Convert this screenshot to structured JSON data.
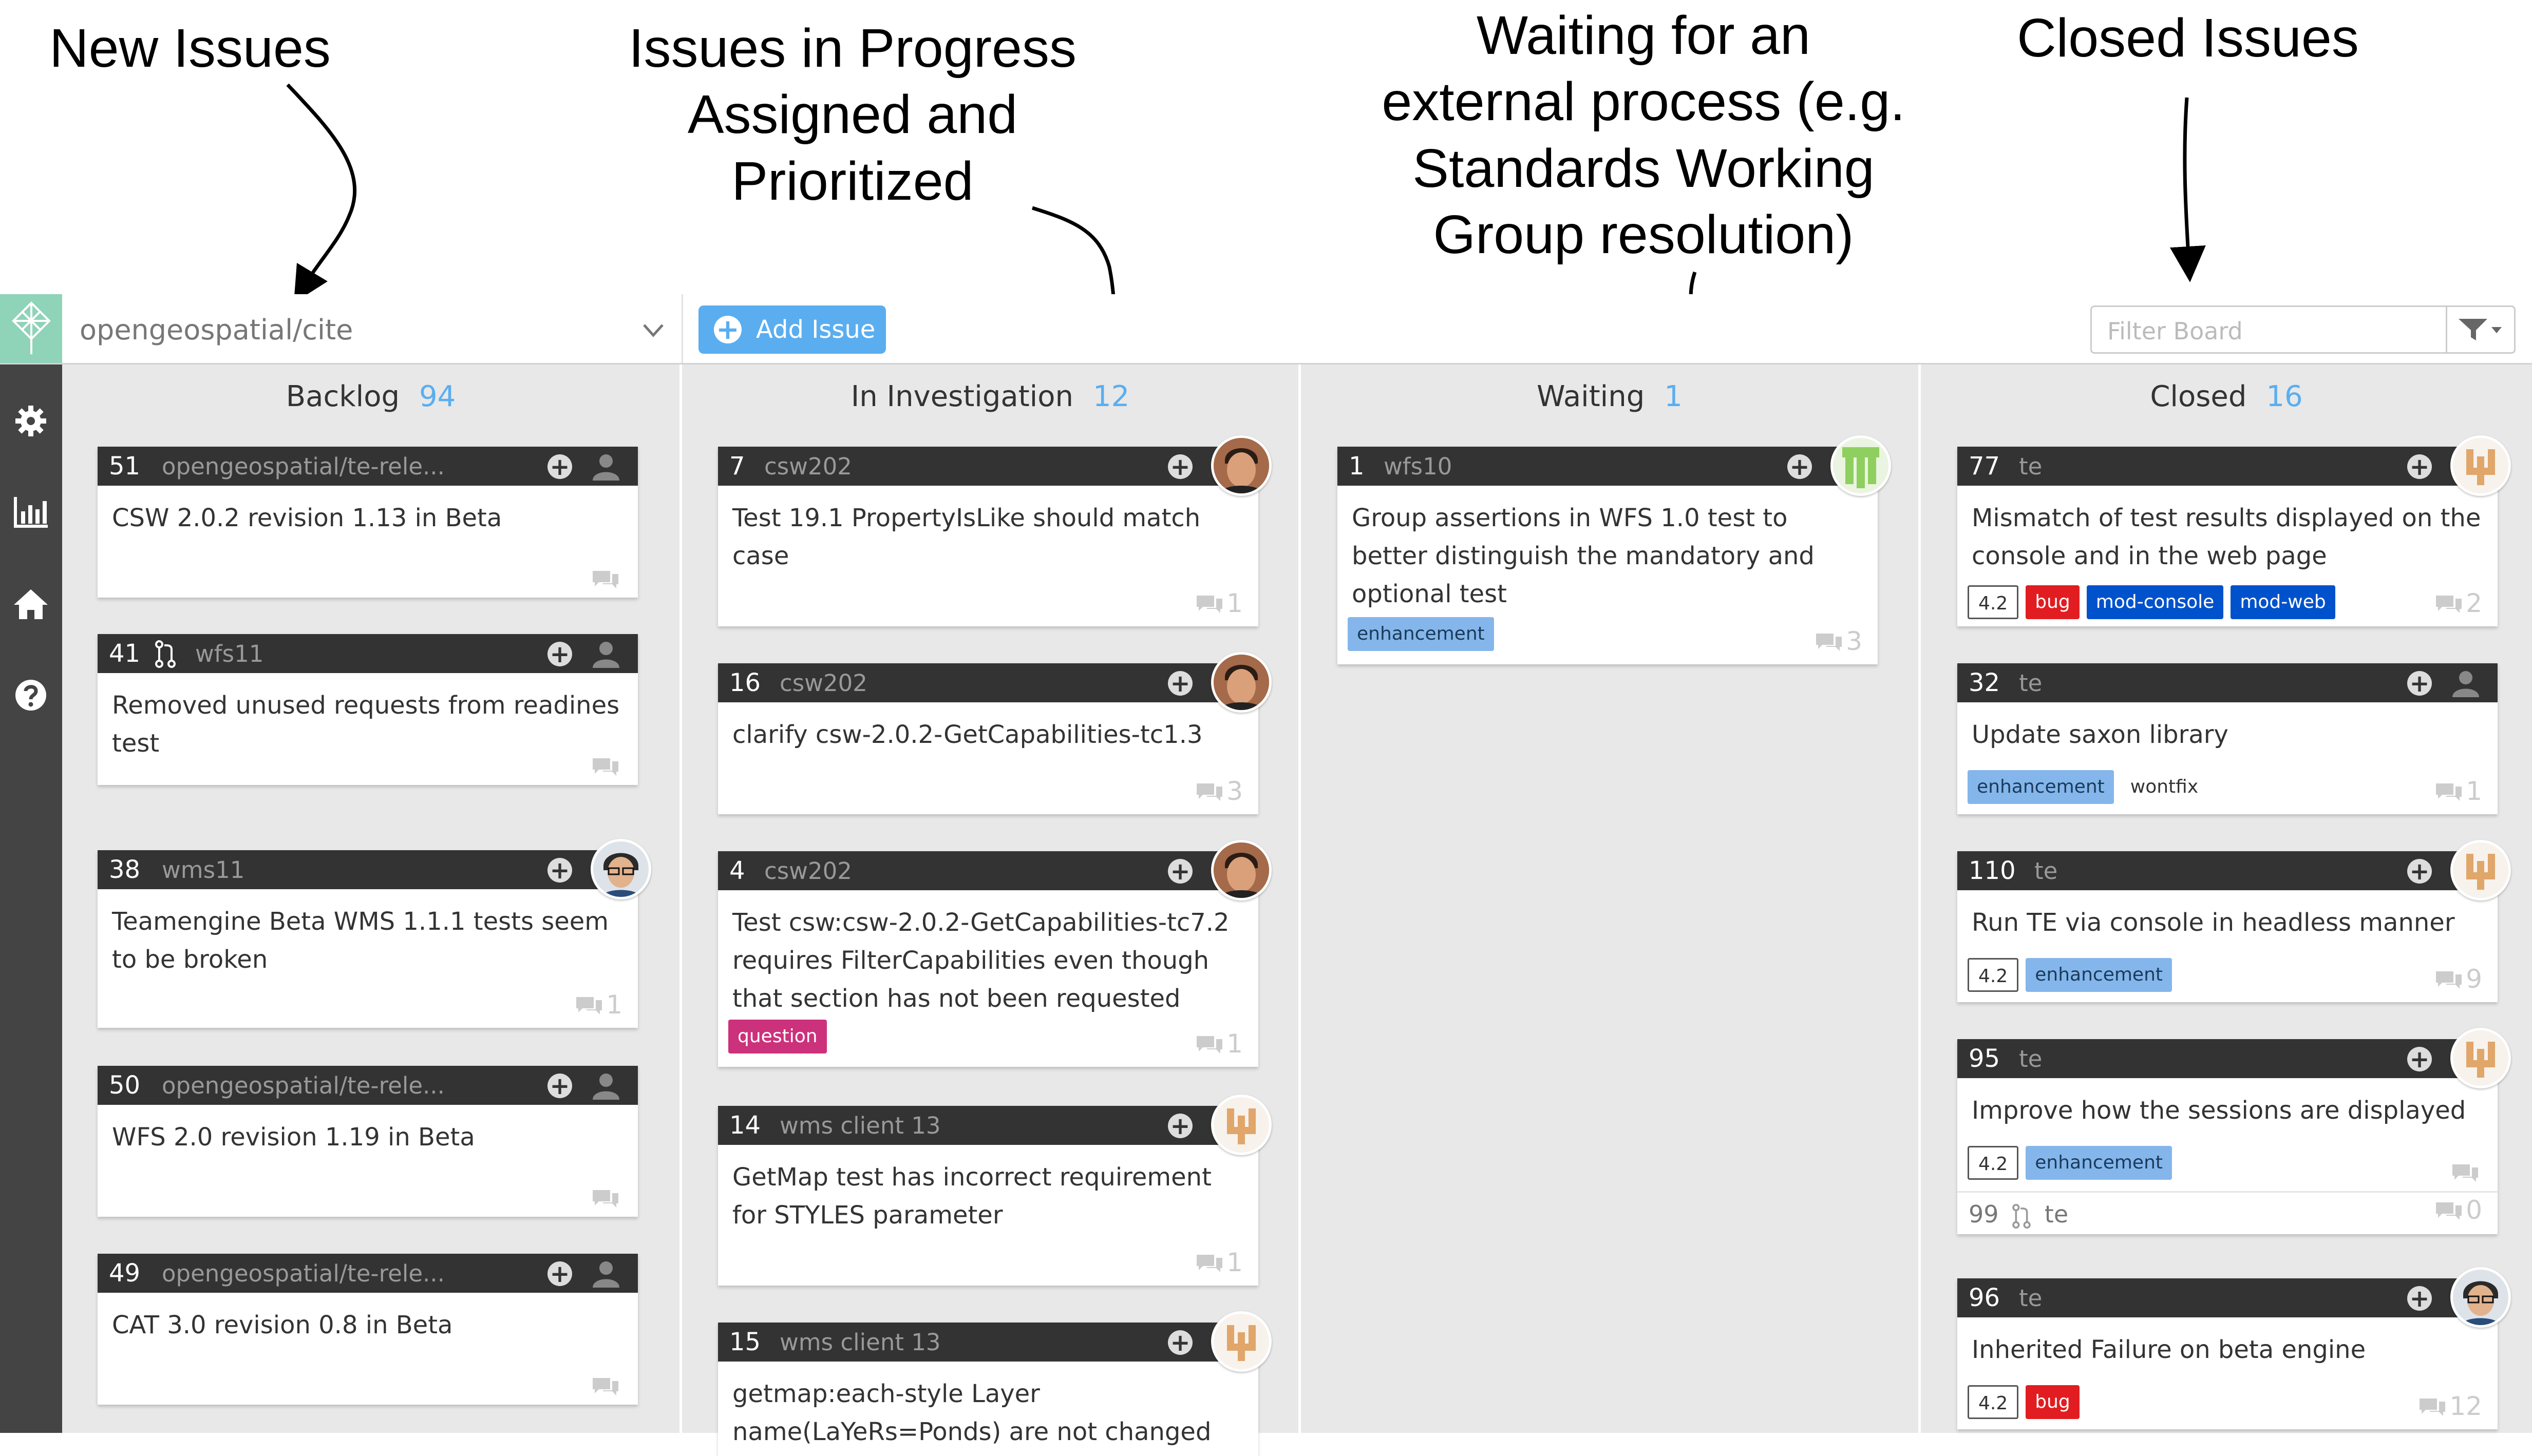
{
  "annotations": {
    "new_issues": "New Issues",
    "in_progress": [
      "Issues in Progress",
      "Assigned and",
      "Prioritized"
    ],
    "waiting": [
      "Waiting for an",
      "external process (e.g.",
      "Standards Working",
      "Group resolution)"
    ],
    "closed": "Closed Issues"
  },
  "topbar": {
    "repo": "opengeospatial/cite",
    "add_issue_label": "Add Issue",
    "filter_placeholder": "Filter Board"
  },
  "sidebar": {
    "icons": [
      "gear-icon",
      "chart-icon",
      "home-icon",
      "help-icon"
    ]
  },
  "columns": [
    {
      "title": "Backlog",
      "count": "94",
      "cards": [
        {
          "number": "51",
          "repo": "opengeospatial/te-rele...",
          "title": "CSW 2.0.2 revision 1.13 in Beta",
          "comments": ""
        },
        {
          "number": "41",
          "repo": "wfs11",
          "title": "Removed unused requests from readines test",
          "comments": "",
          "pull_request": true
        },
        {
          "number": "38",
          "repo": "wms11",
          "title": "Teamengine Beta WMS 1.1.1 tests seem to be broken",
          "comments": "1"
        },
        {
          "number": "50",
          "repo": "opengeospatial/te-rele...",
          "title": "WFS 2.0 revision 1.19 in Beta",
          "comments": ""
        },
        {
          "number": "49",
          "repo": "opengeospatial/te-rele...",
          "title": "CAT 3.0 revision 0.8 in Beta",
          "comments": ""
        }
      ]
    },
    {
      "title": "In Investigation",
      "count": "12",
      "cards": [
        {
          "number": "7",
          "repo": "csw202",
          "title": "Test 19.1 PropertyIsLike should match case",
          "comments": "1"
        },
        {
          "number": "16",
          "repo": "csw202",
          "title": "clarify csw-2.0.2-GetCapabilities-tc1.3",
          "comments": "3"
        },
        {
          "number": "4",
          "repo": "csw202",
          "title": "Test csw:csw-2.0.2-GetCapabilities-tc7.2 requires FilterCapabilities even though that section has not been requested",
          "comments": "1",
          "labels": [
            "question"
          ]
        },
        {
          "number": "14",
          "repo": "wms client 13",
          "title": "GetMap test has incorrect requirement for STYLES parameter",
          "comments": "1"
        },
        {
          "number": "15",
          "repo": "wms client 13",
          "title": "getmap:each-style Layer name(LaYeRs=Ponds) are not changed",
          "comments": ""
        }
      ]
    },
    {
      "title": "Waiting",
      "count": "1",
      "cards": [
        {
          "number": "1",
          "repo": "wfs10",
          "title": "Group assertions in WFS 1.0 test to better distinguish the mandatory and optional test",
          "comments": "3",
          "labels": [
            "enhancement"
          ]
        }
      ]
    },
    {
      "title": "Closed",
      "count": "16",
      "cards": [
        {
          "number": "77",
          "repo": "te",
          "title": "Mismatch of test results displayed on the console and in the web page",
          "comments": "2",
          "labels": [
            "4.2",
            "bug",
            "mod-console",
            "mod-web"
          ]
        },
        {
          "number": "32",
          "repo": "te",
          "title": "Update saxon library",
          "comments": "1",
          "labels": [
            "enhancement",
            "wontfix"
          ]
        },
        {
          "number": "110",
          "repo": "te",
          "title": "Run TE via console in headless manner",
          "comments": "9",
          "labels": [
            "4.2",
            "enhancement"
          ]
        },
        {
          "number": "95",
          "repo": "te",
          "title": "Improve how the sessions are displayed",
          "comments": "",
          "labels": [
            "4.2",
            "enhancement"
          ],
          "pr_number": "99",
          "pr_repo": "te",
          "pr_comments": "0"
        },
        {
          "number": "96",
          "repo": "te",
          "title": "Inherited Failure on beta engine",
          "comments": "12",
          "labels": [
            "4.2",
            "bug"
          ]
        }
      ]
    }
  ],
  "colors": {
    "accent": "#5aaef0",
    "card_header": "#333333",
    "sidebar": "#444444",
    "board_bg": "#e8e8e8",
    "label_enhancement": "#84b6eb",
    "label_bug": "#e11d21",
    "label_mod": "#0052cc",
    "label_question": "#cc317c"
  }
}
